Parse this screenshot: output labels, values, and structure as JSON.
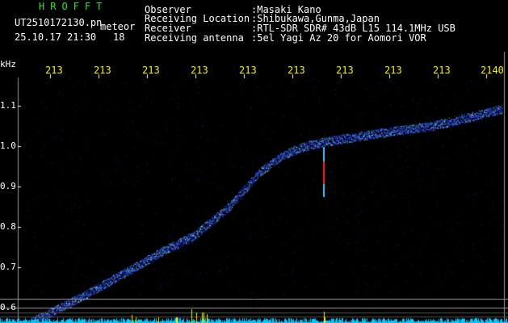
{
  "header": {
    "app_title": "HROFFT",
    "filename": "UT2510172130.pn",
    "mode": "meteor",
    "timestamp": "25.10.17 21:30",
    "count": "18"
  },
  "info": {
    "observer_label": "Observer",
    "observer_value": ":Masaki Kano",
    "location_label": "Receiving Location",
    "location_value": ":Shibukawa,Gunma,Japan",
    "receiver_label": "Receiver",
    "receiver_value": ":RTL-SDR SDR# 43dB L15 114.1MHz USB",
    "antenna_label": "Receiving antenna",
    "antenna_value": ":5el Yagi Az 20 for Aomori VOR"
  },
  "axis": {
    "unit": "kHz",
    "time_ticks": [
      "213",
      "213",
      "213",
      "213",
      "213",
      "213",
      "213",
      "213",
      "213",
      "2140"
    ],
    "freq_ticks": [
      "1.1",
      "1.0",
      "0.9",
      "0.8",
      "0.7",
      "0.6"
    ]
  },
  "colors": {
    "background": "#000000",
    "title": "#2ee62e",
    "tick_text": "#f2f200",
    "plot_border": "#9a9a9a",
    "trail_hot": "#ffffff",
    "trail_warm": "#4cc2ff",
    "trail_cool": "#2a3cff",
    "spike": "#ff2020",
    "power_bar": "#00c8ff"
  }
}
